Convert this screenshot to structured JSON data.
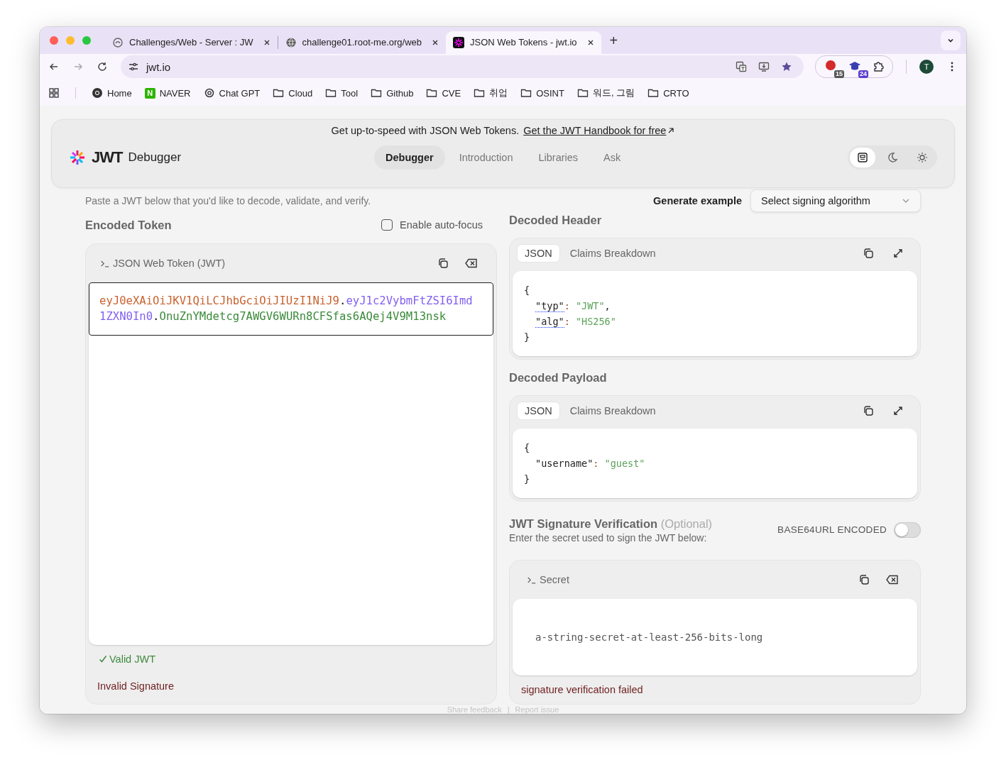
{
  "browser": {
    "tabs": [
      {
        "title": "Challenges/Web - Server : JW",
        "kind": "swirl",
        "selected": false
      },
      {
        "title": "challenge01.root-me.org/web",
        "kind": "globe",
        "selected": false
      },
      {
        "title": "JSON Web Tokens - jwt.io",
        "kind": "jwt",
        "selected": true
      }
    ],
    "new_tab": "+",
    "address": "jwt.io",
    "profile_initial": "T",
    "extensions": [
      {
        "kind": "stop",
        "badge": "15"
      },
      {
        "kind": "cap",
        "badge": "24"
      }
    ],
    "bookmarks": [
      {
        "label": "Home",
        "kind": "chrome"
      },
      {
        "label": "NAVER",
        "kind": "naver",
        "mark": "N"
      },
      {
        "label": "Chat GPT",
        "kind": "openai"
      },
      {
        "label": "Cloud",
        "kind": "folder"
      },
      {
        "label": "Tool",
        "kind": "folder"
      },
      {
        "label": "Github",
        "kind": "folder"
      },
      {
        "label": "CVE",
        "kind": "folder"
      },
      {
        "label": "취업",
        "kind": "folder"
      },
      {
        "label": "OSINT",
        "kind": "folder"
      },
      {
        "label": "워드, 그림",
        "kind": "folder"
      },
      {
        "label": "CRTO",
        "kind": "folder"
      }
    ]
  },
  "banner": {
    "text": "Get up-to-speed with JSON Web Tokens.",
    "link": "Get the JWT Handbook for free"
  },
  "nav": {
    "logo": "JWT",
    "brand": "Debugger",
    "links": [
      {
        "label": "Debugger",
        "selected": true
      },
      {
        "label": "Introduction",
        "selected": false
      },
      {
        "label": "Libraries",
        "selected": false
      },
      {
        "label": "Ask",
        "selected": false
      }
    ],
    "theme_modes": [
      {
        "kind": "system",
        "selected": true
      },
      {
        "kind": "dark",
        "selected": false
      },
      {
        "kind": "light",
        "selected": false
      }
    ]
  },
  "intro": {
    "text": "Paste a JWT below that you'd like to decode, validate, and verify.",
    "generate_label": "Generate example",
    "algorithm_select": {
      "placeholder": "Select signing algorithm"
    }
  },
  "encoded": {
    "heading": "Encoded Token",
    "autofocus": {
      "label": "Enable auto-focus",
      "checked": false
    },
    "panel_title": "JSON Web Token (JWT)",
    "token": [
      {
        "kind": "header",
        "text": "eyJ0eXAiOiJKV1QiLCJhbGciOiJIUzI1NiJ9"
      },
      {
        "kind": "dot",
        "text": "."
      },
      {
        "kind": "payload",
        "text": "eyJ1c2VybmFtZSI6Imd1ZXN0In0"
      },
      {
        "kind": "dot",
        "text": "."
      },
      {
        "kind": "signature",
        "text": "OnuZnYMdetcg7AWGV6WURn8CFSfas6AQej4V9M13nsk"
      }
    ],
    "valid": "Valid JWT",
    "signature_status": "Invalid Signature"
  },
  "decoded": [
    {
      "heading": "Decoded Header",
      "tabs": [
        {
          "label": "JSON",
          "selected": true
        },
        {
          "label": "Claims Breakdown",
          "selected": false
        }
      ],
      "lines": [
        {
          "kind": "brace",
          "text": "{"
        },
        {
          "kind": "pair",
          "key": "\"typ\"",
          "colon": ":",
          "value": "\"JWT\"",
          "end": ",",
          "underlined": true
        },
        {
          "kind": "pair",
          "key": "\"alg\"",
          "colon": ":",
          "value": "\"HS256\"",
          "underlined": true
        },
        {
          "kind": "brace",
          "text": "}"
        }
      ]
    },
    {
      "heading": "Decoded Payload",
      "tabs": [
        {
          "label": "JSON",
          "selected": true
        },
        {
          "label": "Claims Breakdown",
          "selected": false
        }
      ],
      "lines": [
        {
          "kind": "brace",
          "text": "{"
        },
        {
          "kind": "pair",
          "key": "\"username\"",
          "colon": ":",
          "value": "\"guest\"",
          "underlined": false
        },
        {
          "kind": "brace",
          "text": "}"
        }
      ]
    }
  ],
  "signature": {
    "title": "JWT Signature Verification",
    "optional": "(Optional)",
    "subtitle": "Enter the secret used to sign the JWT below:",
    "encoding_toggle": {
      "label": "BASE64URL ENCODED",
      "on": false
    },
    "panel_title": "Secret",
    "secret": "a-string-secret-at-least-256-bits-long",
    "status": "signature verification failed"
  },
  "footer": {
    "links": [
      "Share feedback",
      "Report issue"
    ],
    "separator": "|"
  }
}
